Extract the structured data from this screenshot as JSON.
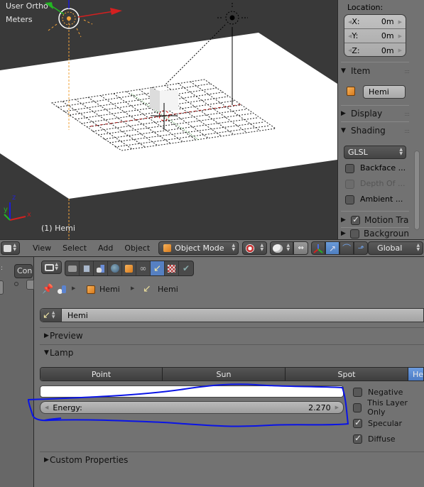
{
  "viewport": {
    "view_label": "User Ortho",
    "units_label": "Meters",
    "active_object_label": "(1) Hemi",
    "axis_labels": {
      "x": "x",
      "y": "y",
      "z": "z"
    },
    "colors": {
      "background": "#393939",
      "ground_plane": "#ffffff",
      "lamp_selected": "#f2a33a",
      "axis_x": "#d42020",
      "axis_y": "#23b523",
      "axis_z": "#1b1bd8"
    }
  },
  "npanel": {
    "location_label": "Location:",
    "location": [
      {
        "axis": "X:",
        "value": "0m"
      },
      {
        "axis": "Y:",
        "value": "0m"
      },
      {
        "axis": "Z:",
        "value": "0m"
      }
    ],
    "sections": {
      "item": {
        "label": "Item",
        "expanded": true,
        "object_name": "Hemi",
        "icon": "object-cube-icon"
      },
      "display": {
        "label": "Display",
        "expanded": false
      },
      "shading": {
        "label": "Shading",
        "expanded": true,
        "mode": "GLSL",
        "options": [
          {
            "label": "Backface ...",
            "checked": false,
            "enabled": true
          },
          {
            "label": "Depth Of ...",
            "checked": false,
            "enabled": false
          },
          {
            "label": "Ambient ...",
            "checked": false,
            "enabled": true
          }
        ]
      },
      "motion_tracking": {
        "label": "Motion Tra",
        "checked": true,
        "expanded": false
      },
      "background": {
        "label": "Backgroun",
        "checked": false,
        "expanded": false
      }
    }
  },
  "header": {
    "editor_type_icon": "3d-view-icon",
    "menus": [
      "View",
      "Select",
      "Add",
      "Object"
    ],
    "mode": "Object Mode",
    "mode_icon": "object-cube-icon",
    "shading_icon": "viewport-shading-icon",
    "pivot_icon": "pivot-point-icon",
    "manipulator_icons": [
      "manipulator-toggle-icon",
      "translate-icon",
      "rotate-icon",
      "scale-icon"
    ],
    "orientation": "Global"
  },
  "left_strip": {
    "tab_label": "Cont"
  },
  "properties": {
    "context_tabs": [
      {
        "name": "render",
        "icon": "camera-icon",
        "active": false
      },
      {
        "name": "render-layers",
        "icon": "render-layers-icon",
        "active": false
      },
      {
        "name": "scene",
        "icon": "scene-icon",
        "active": false
      },
      {
        "name": "world",
        "icon": "world-icon",
        "active": false
      },
      {
        "name": "object",
        "icon": "object-cube-icon",
        "active": false
      },
      {
        "name": "constraints",
        "icon": "constraint-link-icon",
        "active": false
      },
      {
        "name": "lamp-data",
        "icon": "lamp-hemi-icon",
        "active": true
      },
      {
        "name": "texture",
        "icon": "texture-icon",
        "active": false
      },
      {
        "name": "scene-data",
        "icon": "scene-data-icon",
        "active": false
      }
    ],
    "breadcrumb": [
      {
        "label": "Hemi",
        "icon": "object-cube-icon"
      },
      {
        "label": "Hemi",
        "icon": "lamp-hemi-icon"
      }
    ],
    "lamp_datablock": "Hemi",
    "panels": {
      "preview": {
        "label": "Preview",
        "expanded": false
      },
      "lamp": {
        "label": "Lamp",
        "expanded": true
      },
      "custom_properties": {
        "label": "Custom Properties",
        "expanded": false
      }
    },
    "lamp_types": [
      {
        "label": "Point",
        "active": false
      },
      {
        "label": "Sun",
        "active": false
      },
      {
        "label": "Spot",
        "active": false
      },
      {
        "label": "Hemi",
        "active": true
      }
    ],
    "color": "#ffffff",
    "energy": {
      "label": "Energy:",
      "value": "2.270"
    },
    "options": [
      {
        "label": "Negative",
        "checked": false
      },
      {
        "label": "This Layer Only",
        "checked": false
      },
      {
        "label": "Specular",
        "checked": true
      },
      {
        "label": "Diffuse",
        "checked": true
      }
    ],
    "accent_color": "#5680c2"
  },
  "annotation": {
    "shape": "hand-drawn outline around Energy field",
    "color": "#0a14e6"
  }
}
